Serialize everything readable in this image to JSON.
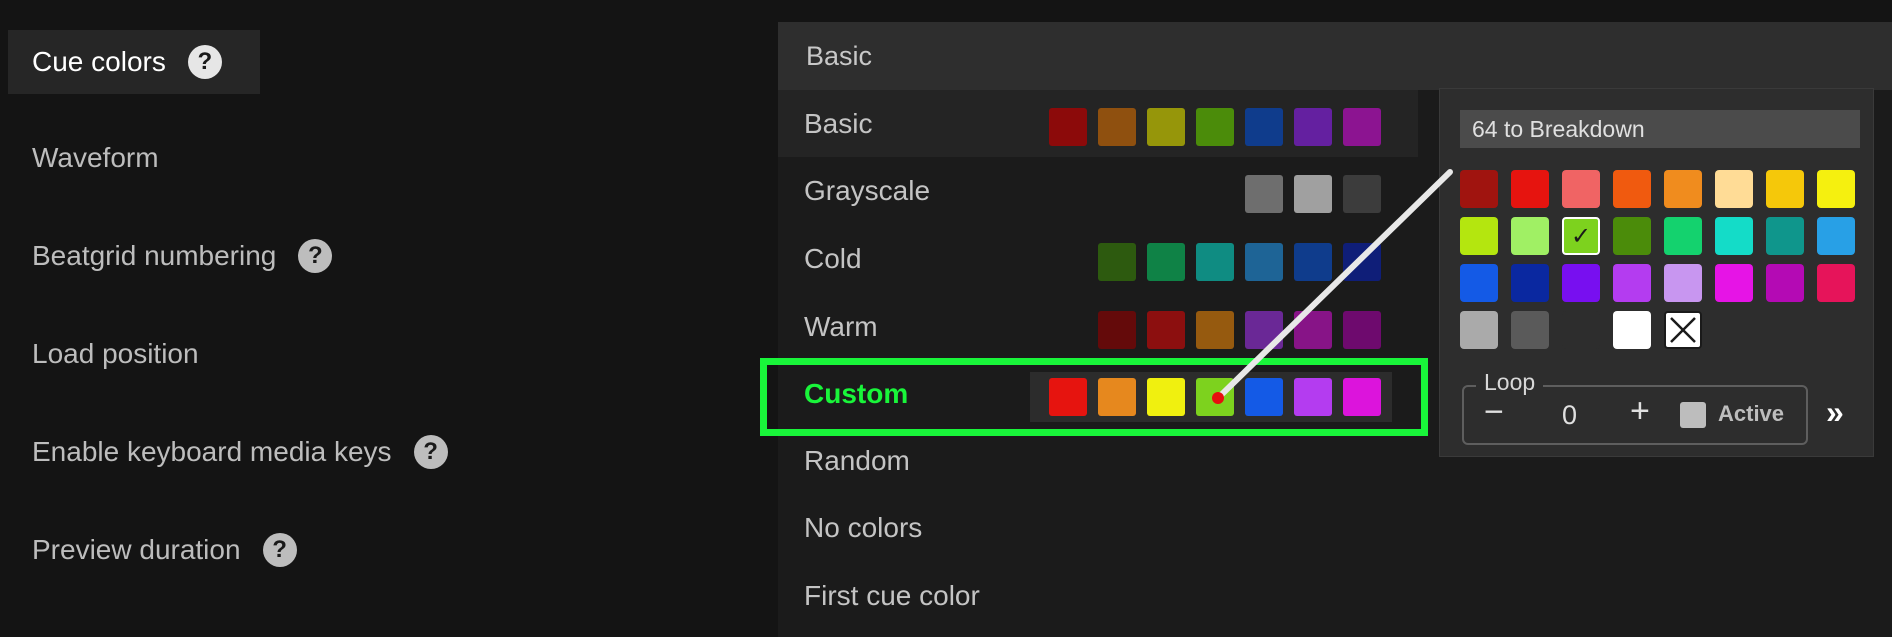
{
  "settings": {
    "items": [
      {
        "label": "Cue colors",
        "help": "?"
      },
      {
        "label": "Waveform"
      },
      {
        "label": "Beatgrid numbering",
        "help": "?"
      },
      {
        "label": "Load position"
      },
      {
        "label": "Enable keyboard media keys",
        "help": "?"
      },
      {
        "label": "Preview duration",
        "help": "?"
      }
    ]
  },
  "dropdown": {
    "selected": "Basic",
    "options": [
      {
        "label": "Basic",
        "colors": [
          "#8c0a0a",
          "#8f500f",
          "#96960a",
          "#4b8c0a",
          "#0f3c8c",
          "#6420a0",
          "#8c1491"
        ]
      },
      {
        "label": "Grayscale",
        "colors": [
          "#6e6e6e",
          "#a0a0a0",
          "#3c3c3c"
        ]
      },
      {
        "label": "Cold",
        "colors": [
          "#2d5a0f",
          "#0f8246",
          "#0f8c82",
          "#1e6496",
          "#0f3c8c",
          "#0f1e78"
        ]
      },
      {
        "label": "Warm",
        "colors": [
          "#640a0a",
          "#8c0f0f",
          "#965a0f",
          "#6a2896",
          "#871487",
          "#6e0a6e"
        ]
      },
      {
        "label": "Custom",
        "colors": [
          "#e6140f",
          "#e6881e",
          "#f0f00f",
          "#7dd21e",
          "#145ae6",
          "#b43cf0",
          "#dc14dc"
        ]
      },
      {
        "label": "Random"
      },
      {
        "label": "No colors"
      },
      {
        "label": "First cue color"
      }
    ]
  },
  "picker": {
    "cue_name": "64 to Breakdown",
    "colors": [
      "#a0140f",
      "#e6140f",
      "#f06464",
      "#f05a0f",
      "#f08c1e",
      "#ffdc96",
      "#f5c80a",
      "#f5f00f",
      "#b4e60f",
      "#a0f064",
      "#7dd21e",
      "#4b8c0a",
      "#14d26e",
      "#14dcc8",
      "#0f968c",
      "#28a0e6",
      "#145ae6",
      "#0a28a0",
      "#780ff0",
      "#b43cf0",
      "#c896f0",
      "#e614e6",
      "#b40ab4",
      "#e6145a",
      "#aaaaaa",
      "#5a5a5a",
      "#2d2d2d",
      "#ffffff"
    ],
    "selected_index": 10,
    "selected_mark": "✓",
    "no_color_icon": "x-icon",
    "loop": {
      "label": "Loop",
      "minus": "−",
      "value": "0",
      "plus": "+",
      "active_label": "Active"
    },
    "next_icon": "»"
  },
  "highlight_color": "#19f53a"
}
